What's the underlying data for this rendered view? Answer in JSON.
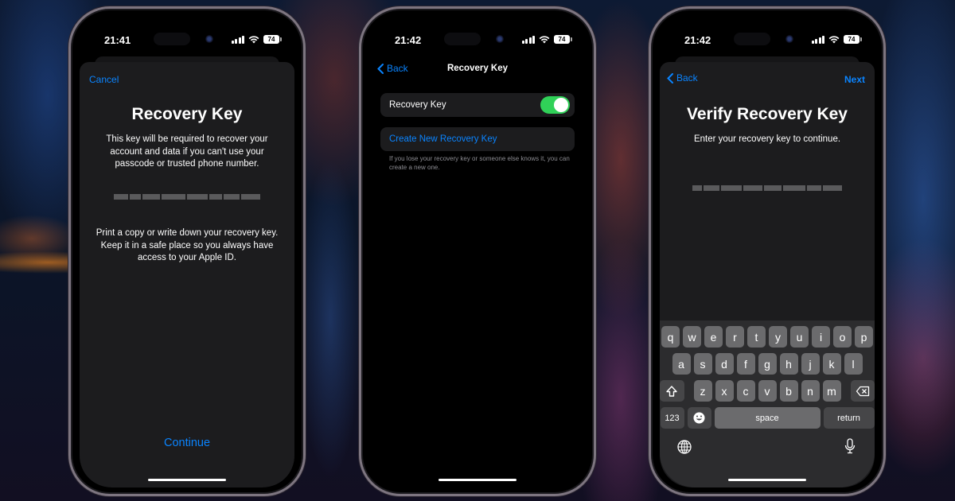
{
  "phones": [
    {
      "status": {
        "time": "21:41",
        "battery": "74"
      },
      "nav": {
        "left_link": "Cancel"
      },
      "title": "Recovery Key",
      "intro": "This key will be required to recover your account and data if you can't use your passcode or trusted phone number.",
      "key_display": "(recovery key obscured)",
      "instructions": "Print a copy or write down your recovery key. Keep it in a safe place so you always have access to your Apple ID.",
      "primary_action": "Continue"
    },
    {
      "status": {
        "time": "21:42",
        "battery": "74"
      },
      "nav": {
        "back_label": "Back",
        "title": "Recovery Key"
      },
      "toggle_row": {
        "label": "Recovery Key",
        "state": "on"
      },
      "action_row": {
        "label": "Create New Recovery Key"
      },
      "footnote": "If you lose your recovery key or someone else knows it, you can create a new one."
    },
    {
      "status": {
        "time": "21:42",
        "battery": "74"
      },
      "nav": {
        "back_label": "Back",
        "next_label": "Next"
      },
      "title": "Verify Recovery Key",
      "subtitle": "Enter your recovery key to continue.",
      "key_input": "(recovery key obscured)",
      "keyboard": {
        "row1": [
          "q",
          "w",
          "e",
          "r",
          "t",
          "y",
          "u",
          "i",
          "o",
          "p"
        ],
        "row2": [
          "a",
          "s",
          "d",
          "f",
          "g",
          "h",
          "j",
          "k",
          "l"
        ],
        "row3": [
          "z",
          "x",
          "c",
          "v",
          "b",
          "n",
          "m"
        ],
        "numbers_key": "123",
        "space_key": "space",
        "return_key": "return"
      }
    }
  ],
  "colors": {
    "accent": "#0a84ff",
    "toggle_on": "#30d158",
    "sheet": "#1c1c1e"
  }
}
